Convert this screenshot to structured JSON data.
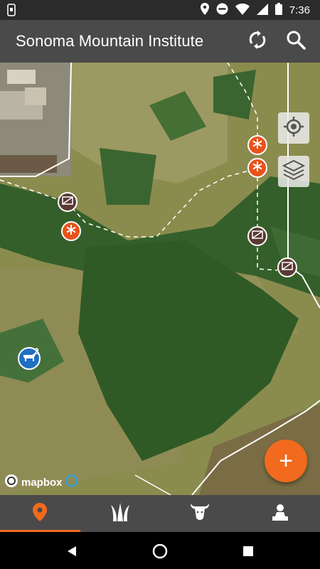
{
  "status_bar": {
    "time": "7:36",
    "icons": [
      "notification-icon",
      "location-icon",
      "do-not-disturb-icon",
      "wifi-icon",
      "signal-icon",
      "battery-icon"
    ]
  },
  "app_bar": {
    "title": "Sonoma Mountain Institute",
    "actions": [
      "sync-icon",
      "search-icon"
    ]
  },
  "map": {
    "attribution": "mapbox",
    "controls": [
      "my-location-icon",
      "layers-icon"
    ],
    "herd_marker": {
      "count": "2"
    },
    "markers": [
      "gate",
      "point",
      "point",
      "point",
      "gate",
      "gate"
    ]
  },
  "fab": {
    "icon": "add-icon",
    "label": "+"
  },
  "bottom_nav": {
    "items": [
      {
        "name": "map",
        "icon": "map-pin-icon",
        "active": true
      },
      {
        "name": "pasture",
        "icon": "grass-icon",
        "active": false
      },
      {
        "name": "herds",
        "icon": "bull-icon",
        "active": false
      },
      {
        "name": "account",
        "icon": "person-icon",
        "active": false
      }
    ]
  },
  "colors": {
    "accent": "#f16a1e",
    "app_bar": "#4a4a4a",
    "status_bar": "#2b2b2b",
    "herd": "#1f6fc2",
    "gate_marker": "#5a3a34"
  }
}
